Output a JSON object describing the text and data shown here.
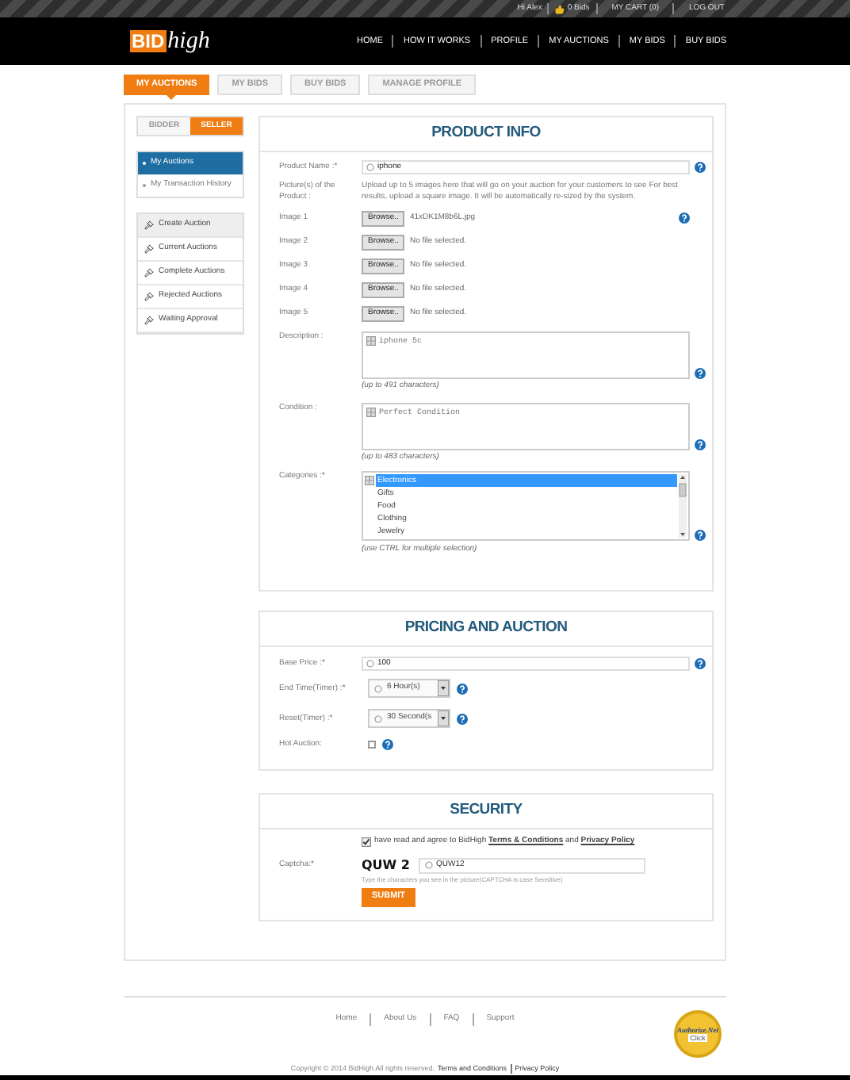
{
  "top_bar": {
    "greeting": "Hi Alex",
    "bids": "0 Bids",
    "cart": "MY CART (0)",
    "logout": "LOG OUT"
  },
  "logo": {
    "part_1": "BID",
    "part_2": "high"
  },
  "nav": [
    "HOME",
    "HOW IT WORKS",
    "PROFILE",
    "MY AUCTIONS",
    "MY BIDS",
    "BUY BIDS"
  ],
  "tabs": [
    {
      "label": "MY AUCTIONS",
      "selected": true
    },
    {
      "label": "MY BIDS",
      "selected": false
    },
    {
      "label": "BUY BIDS",
      "selected": false
    },
    {
      "label": "MANAGE PROFILE",
      "selected": false
    }
  ],
  "role_toggle": [
    {
      "label": "BIDDER",
      "selected": false
    },
    {
      "label": "SELLER",
      "selected": true
    }
  ],
  "account_menu": [
    {
      "label": "My Auctions",
      "selected": true
    },
    {
      "label": "My Transaction History",
      "selected": false
    }
  ],
  "auction_menu": [
    {
      "label": "Create Auction",
      "selected": true
    },
    {
      "label": "Current Auctions",
      "selected": false
    },
    {
      "label": "Complete Auctions",
      "selected": false
    },
    {
      "label": "Rejected Auctions",
      "selected": false
    },
    {
      "label": "Waiting Approval",
      "selected": false
    }
  ],
  "product_info": {
    "title": "PRODUCT INFO",
    "product_name": {
      "label": "Product Name :*",
      "value": "iphone"
    },
    "pictures": {
      "label": "Picture(s) of the Product :",
      "hint": "Upload up to 5 images here that will go on your auction for your customers to see For best results, upload a square image. It will be automatically re-sized by the system."
    },
    "images": [
      {
        "label": "Image 1",
        "button": "Browse..",
        "file": "41xDK1M8b6L.jpg"
      },
      {
        "label": "Image 2",
        "button": "Browse..",
        "file": "No file selected."
      },
      {
        "label": "Image 3",
        "button": "Browse..",
        "file": "No file selected."
      },
      {
        "label": "Image 4",
        "button": "Browse..",
        "file": "No file selected."
      },
      {
        "label": "Image 5",
        "button": "Browse..",
        "file": "No file selected."
      }
    ],
    "description": {
      "label": "Description :",
      "value": "iphone 5c",
      "note": "(up to 491 characters)"
    },
    "condition": {
      "label": "Condition :",
      "value": "Perfect Condition",
      "note": "(up to 483 characters)"
    },
    "categories": {
      "label": "Categories :*",
      "note": "(use CTRL for multiple selection)",
      "options": [
        {
          "label": "Electronics",
          "selected": true
        },
        {
          "label": "Gifts",
          "selected": false
        },
        {
          "label": "Food",
          "selected": false
        },
        {
          "label": "Clothing",
          "selected": false
        },
        {
          "label": "Jewelry",
          "selected": false
        }
      ]
    }
  },
  "pricing": {
    "title": "PRICING AND AUCTION",
    "base_price": {
      "label": "Base Price :*",
      "value": "100"
    },
    "end_time": {
      "label": "End Time(Timer) :*",
      "value": "6 Hour(s)"
    },
    "reset": {
      "label": "Reset(Timer) :*",
      "value": "30 Second(s"
    },
    "hot_auction": {
      "label": "Hot Auction:",
      "checked": false
    }
  },
  "security": {
    "title": "SECURITY",
    "agree": {
      "checked": true,
      "text": "have read and agree to BidHigh",
      "terms": "Terms & Conditions",
      "and": "and",
      "privacy": "Privacy Policy"
    },
    "captcha": {
      "label": "Captcha:*",
      "image_text": "QUW 2",
      "value": "QUW12",
      "hint": "Type the characters you see in the picture(CAPTCHA is case Sensitive)"
    },
    "submit": "SUBMIT"
  },
  "footer": {
    "links": [
      "Home",
      "About Us",
      "FAQ",
      "Support"
    ],
    "copyright": "Copyright © 2014 BidHigh.All rights reserved.",
    "terms": "Terms and Conditions",
    "privacy": "Privacy Policy"
  },
  "seal": {
    "title": "Authorize.Net",
    "subtitle": "Click"
  }
}
